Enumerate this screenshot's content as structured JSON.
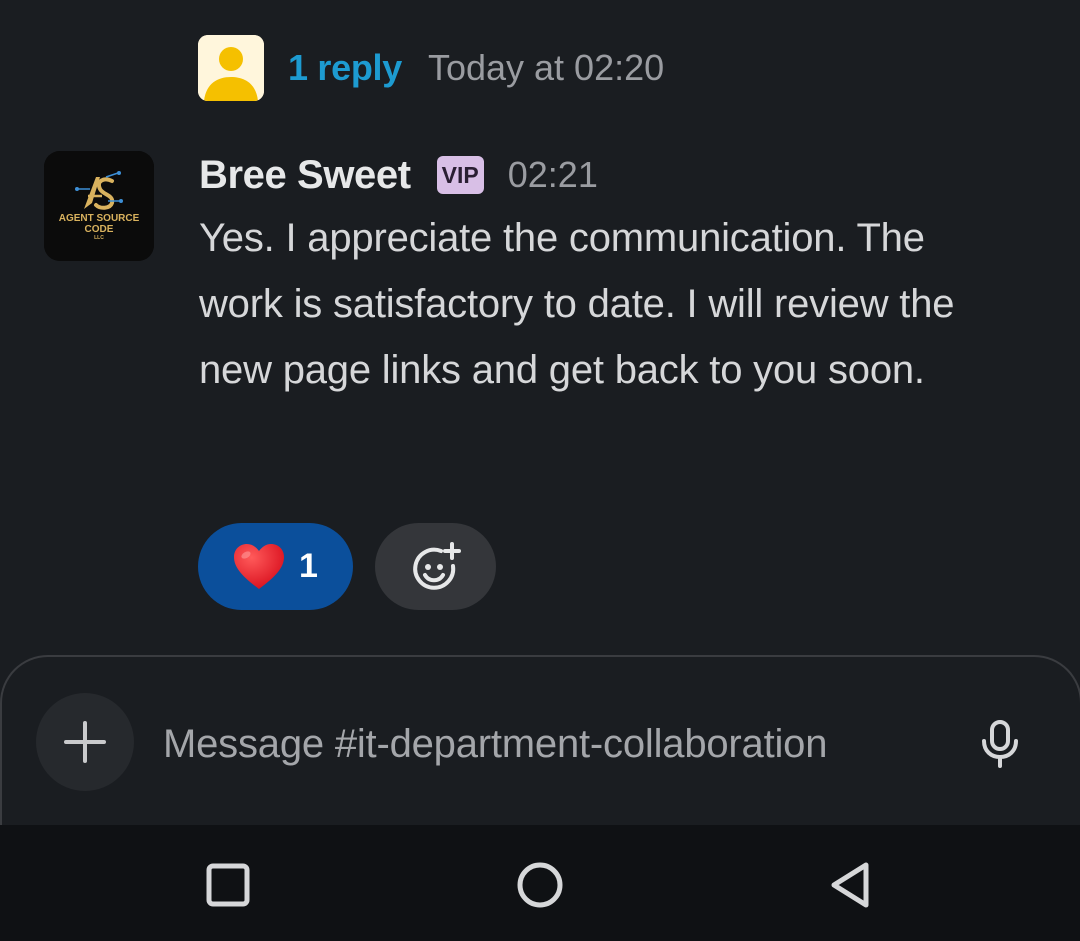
{
  "thread": {
    "reply_count": "1 reply",
    "reply_time": "Today at 02:20"
  },
  "message": {
    "author": "Bree Sweet",
    "badge": "VIP",
    "time": "02:21",
    "text": "Yes. I appreciate the communication. The work is satisfactory to date. I will review the new page links and get back to you soon.",
    "avatar_logo": {
      "line1": "AGENT SOURCE",
      "line2": "CODE",
      "line3": "LLC"
    }
  },
  "reactions": [
    {
      "emoji": "heart-icon",
      "count": "1",
      "active": true
    }
  ],
  "composer": {
    "placeholder": "Message #it-department-collaboration"
  },
  "colors": {
    "background": "#1a1d21",
    "link": "#1d9bd1",
    "reaction_active": "#0b4f9b",
    "vip_badge": "#d8bfe6"
  },
  "navbar": {
    "buttons": [
      "recents-icon",
      "home-icon",
      "back-icon"
    ]
  }
}
